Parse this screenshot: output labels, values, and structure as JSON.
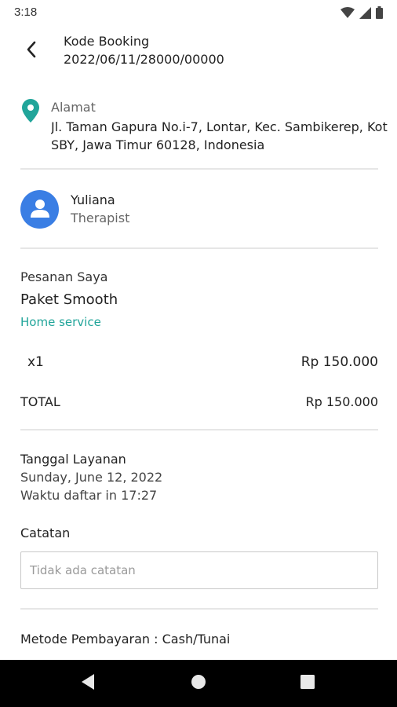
{
  "status_bar": {
    "time": "3:18",
    "icons": [
      "wifi-icon",
      "signal-icon",
      "battery-icon"
    ]
  },
  "header": {
    "title": "Kode Booking",
    "booking_code": "2022/06/11/28000/00000",
    "back_icon": "arrow-left-icon"
  },
  "address": {
    "icon": "location-pin-icon",
    "label": "Alamat",
    "text": "Jl. Taman Gapura No.i-7, Lontar, Kec. Sambikerep, Kot\nSBY, Jawa Timur 60128, Indonesia"
  },
  "therapist": {
    "avatar_icon": "person-icon",
    "name": "Yuliana",
    "role": "Therapist"
  },
  "order": {
    "section_label": "Pesanan Saya",
    "item_name": "Paket Smooth",
    "service_type": "Home service",
    "quantity": "x1",
    "price": "Rp 150.000",
    "total_label": "TOTAL",
    "total_value": "Rp 150.000"
  },
  "schedule": {
    "label": "Tanggal Layanan",
    "date": "Sunday, June 12, 2022",
    "time": "Waktu daftar in 17:27"
  },
  "notes": {
    "label": "Catatan",
    "placeholder": "Tidak ada catatan",
    "value": ""
  },
  "payment": {
    "method_text": "Metode Pembayaran : Cash/Tunai"
  },
  "nav_bar": {
    "buttons": [
      "back-triangle-icon",
      "home-circle-icon",
      "recents-square-icon"
    ]
  },
  "colors": {
    "accent_teal": "#21a59a",
    "avatar_blue": "#3a7ee4",
    "divider": "#e6e6e6"
  }
}
